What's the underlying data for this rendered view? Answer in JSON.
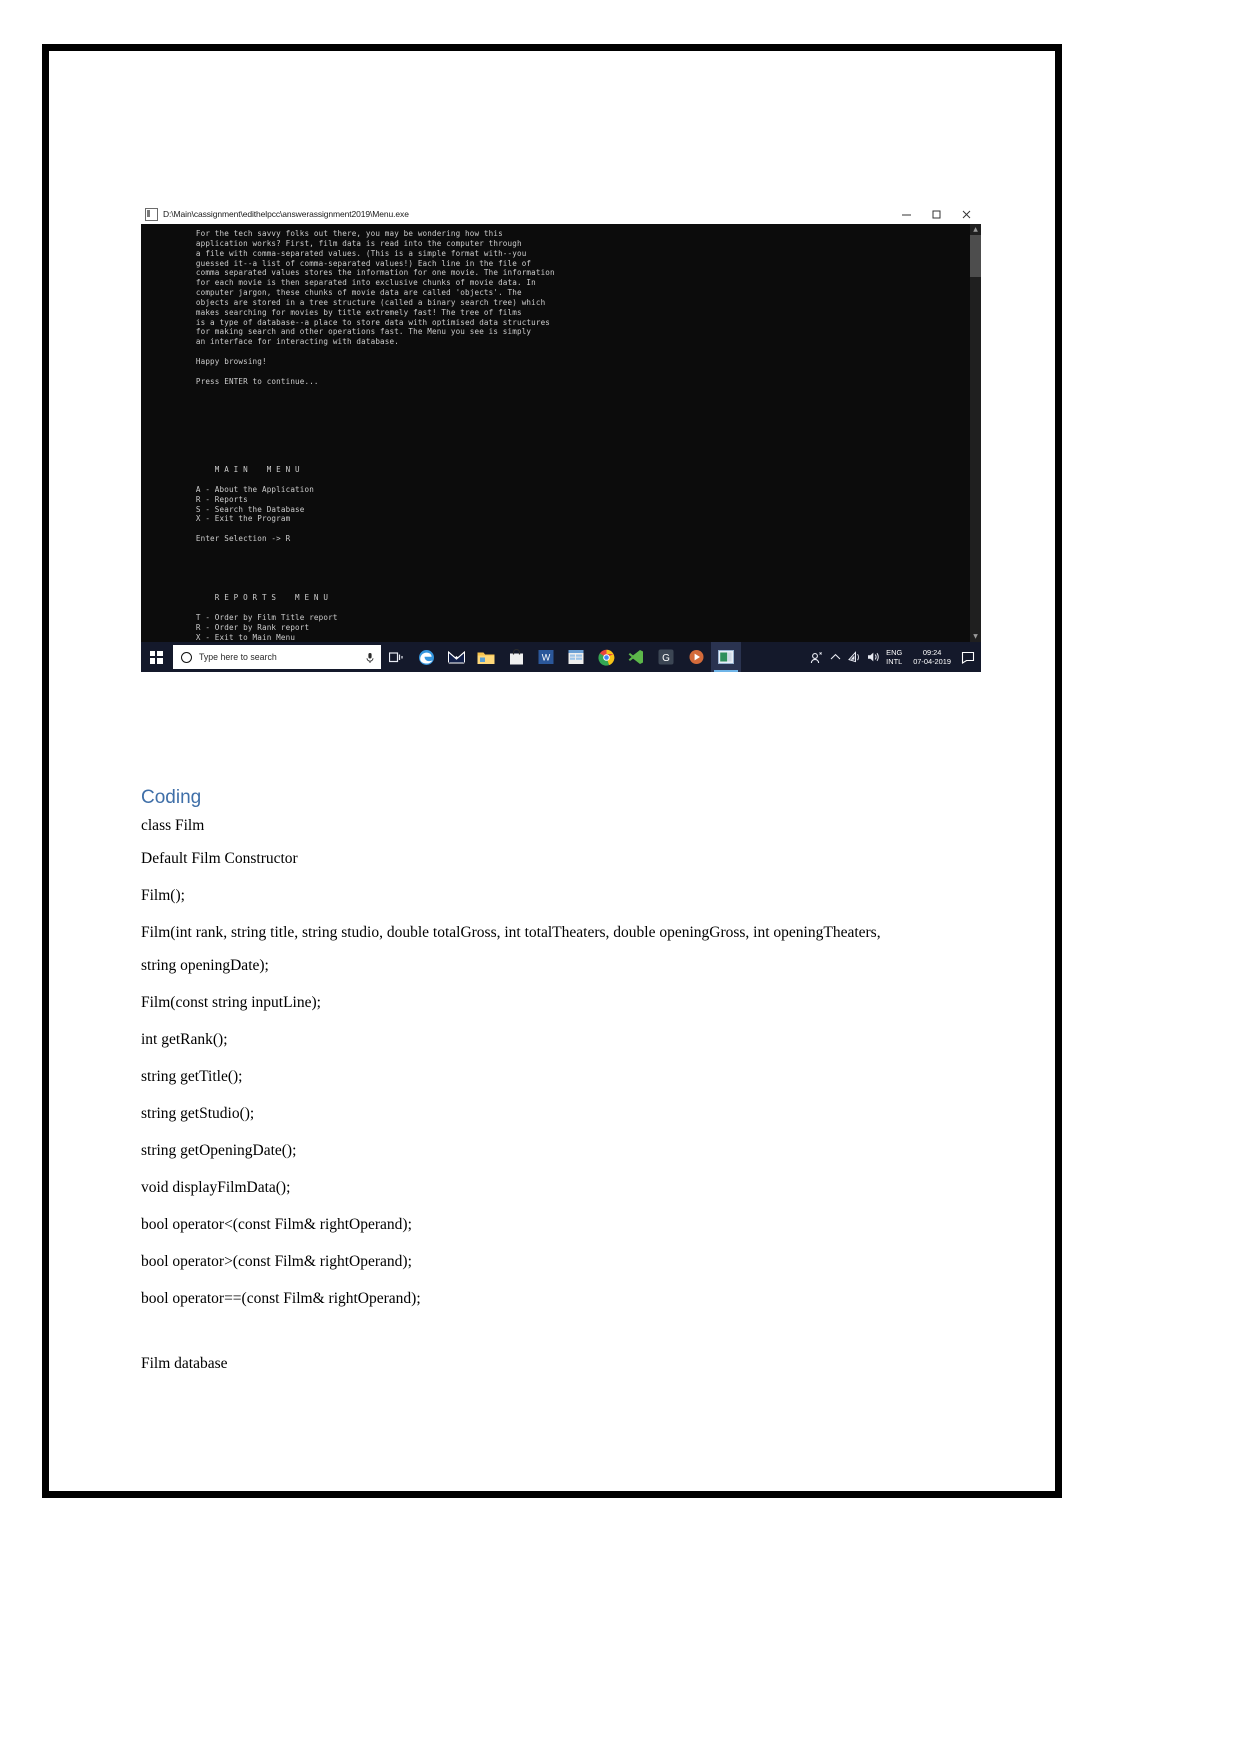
{
  "window": {
    "title": "D:\\Main\\cassignment\\edithelpcc\\answerassignment2019\\Menu.exe",
    "minimize_label": "—",
    "maximize_label": "❐",
    "close_label": "✕"
  },
  "console": {
    "text": "    For the tech savvy folks out there, you may be wondering how this\n    application works? First, film data is read into the computer through\n    a file with comma-separated values. (This is a simple format with--you\n    guessed it--a list of comma-separated values!) Each line in the file of\n    comma separated values stores the information for one movie. The information\n    for each movie is then separated into exclusive chunks of movie data. In\n    computer jargon, these chunks of movie data are called 'objects'. The\n    objects are stored in a tree structure (called a binary search tree) which\n    makes searching for movies by title extremely fast! The tree of films\n    is a type of database--a place to store data with optimised data structures\n    for making search and other operations fast. The Menu you see is simply\n    an interface for interacting with database.\n\n    Happy browsing!\n\n    Press ENTER to continue...\n\n\n\n\n\n\n\n\n        M A I N    M E N U\n\n    A - About the Application\n    R - Reports\n    S - Search the Database\n    X - Exit the Program\n\n    Enter Selection -> R\n\n\n\n\n\n        R E P O R T S    M E N U\n\n    T - Order by Film Title report\n    R - Order by Rank report\n    X - Exit to Main Menu\n\n    Enter Selection ->"
  },
  "taskbar": {
    "search_placeholder": "Type here to search",
    "language": "ENG",
    "language_sub": "INTL",
    "time": "09:24",
    "date": "07-04-2019"
  },
  "document": {
    "heading": "Coding",
    "lines": [
      "class Film",
      "Default Film Constructor",
      "Film();",
      "Film(int rank, string title, string studio, double totalGross, int totalTheaters, double openingGross, int openingTheaters,",
      "string openingDate);",
      "Film(const string inputLine);",
      "int getRank();",
      "string getTitle();",
      "string getStudio();",
      "string getOpeningDate();",
      "void displayFilmData();",
      "bool operator<(const Film& rightOperand);",
      "bool operator>(const Film& rightOperand);",
      "bool operator==(const Film& rightOperand);",
      "Film database"
    ]
  }
}
